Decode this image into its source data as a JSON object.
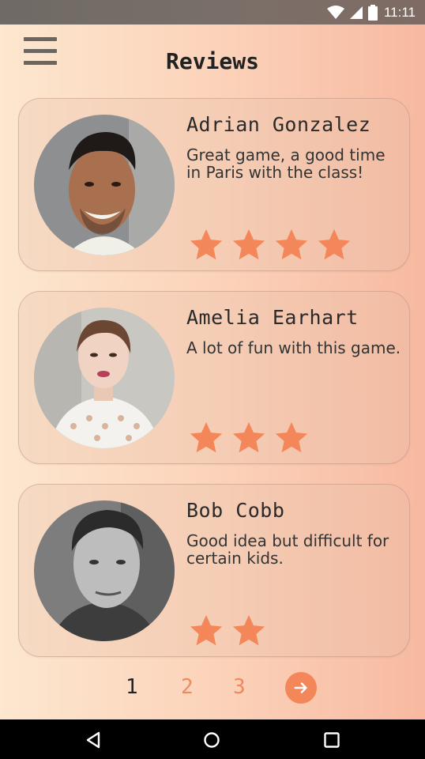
{
  "status_bar": {
    "time": "11:11",
    "icons": [
      "wifi-icon",
      "signal-icon",
      "battery-icon"
    ]
  },
  "header": {
    "title": "Reviews",
    "menu_icon": "hamburger-menu-icon"
  },
  "reviews": [
    {
      "name": "Adrian Gonzalez",
      "text": "Great game, a good time in Paris with the class!",
      "rating": 4
    },
    {
      "name": "Amelia Earhart",
      "text": "A lot of fun with this game.",
      "rating": 3
    },
    {
      "name": "Bob Cobb",
      "text": "Good idea but difficult for certain kids.",
      "rating": 2
    }
  ],
  "pagination": {
    "pages": [
      "1",
      "2",
      "3"
    ],
    "current": "1",
    "next_icon": "arrow-right-icon"
  },
  "colors": {
    "accent": "#f4875a",
    "star": "#f4875a"
  },
  "nav_bar": {
    "icons": [
      "back-icon",
      "home-icon",
      "recents-icon"
    ]
  }
}
